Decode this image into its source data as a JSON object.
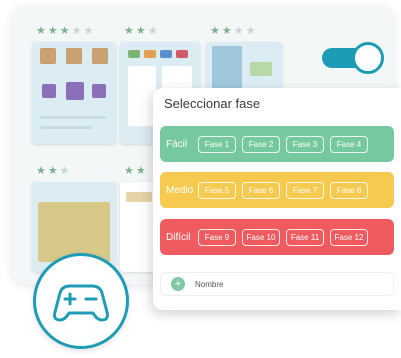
{
  "popup": {
    "title": "Seleccionar fase",
    "levels": [
      {
        "label": "Fácil",
        "phases": [
          "Fase 1",
          "Fase 2",
          "Fase 3",
          "Fase 4"
        ]
      },
      {
        "label": "Medio",
        "phases": [
          "Fase 5",
          "Fase 6",
          "Fase 7",
          "Fase 8"
        ]
      },
      {
        "label": "Difícil",
        "phases": [
          "Fase 9",
          "Fase 10",
          "Fase 11",
          "Fase 12"
        ]
      }
    ],
    "name_placeholder": "Nombre",
    "add_icon": "+"
  },
  "cards": [
    {
      "stars": 3
    },
    {
      "stars": 2
    },
    {
      "stars": 2
    },
    {
      "stars": 2
    },
    {
      "stars": 2
    }
  ],
  "colors": {
    "accent": "#1e9bb5",
    "easy": "#76c99f",
    "medium": "#f6c94f",
    "hard": "#ef5b5e",
    "star_on": "#7ab38c"
  },
  "icons": {
    "toggle": "toggle-switch-icon",
    "gamepad": "gamepad-icon"
  }
}
